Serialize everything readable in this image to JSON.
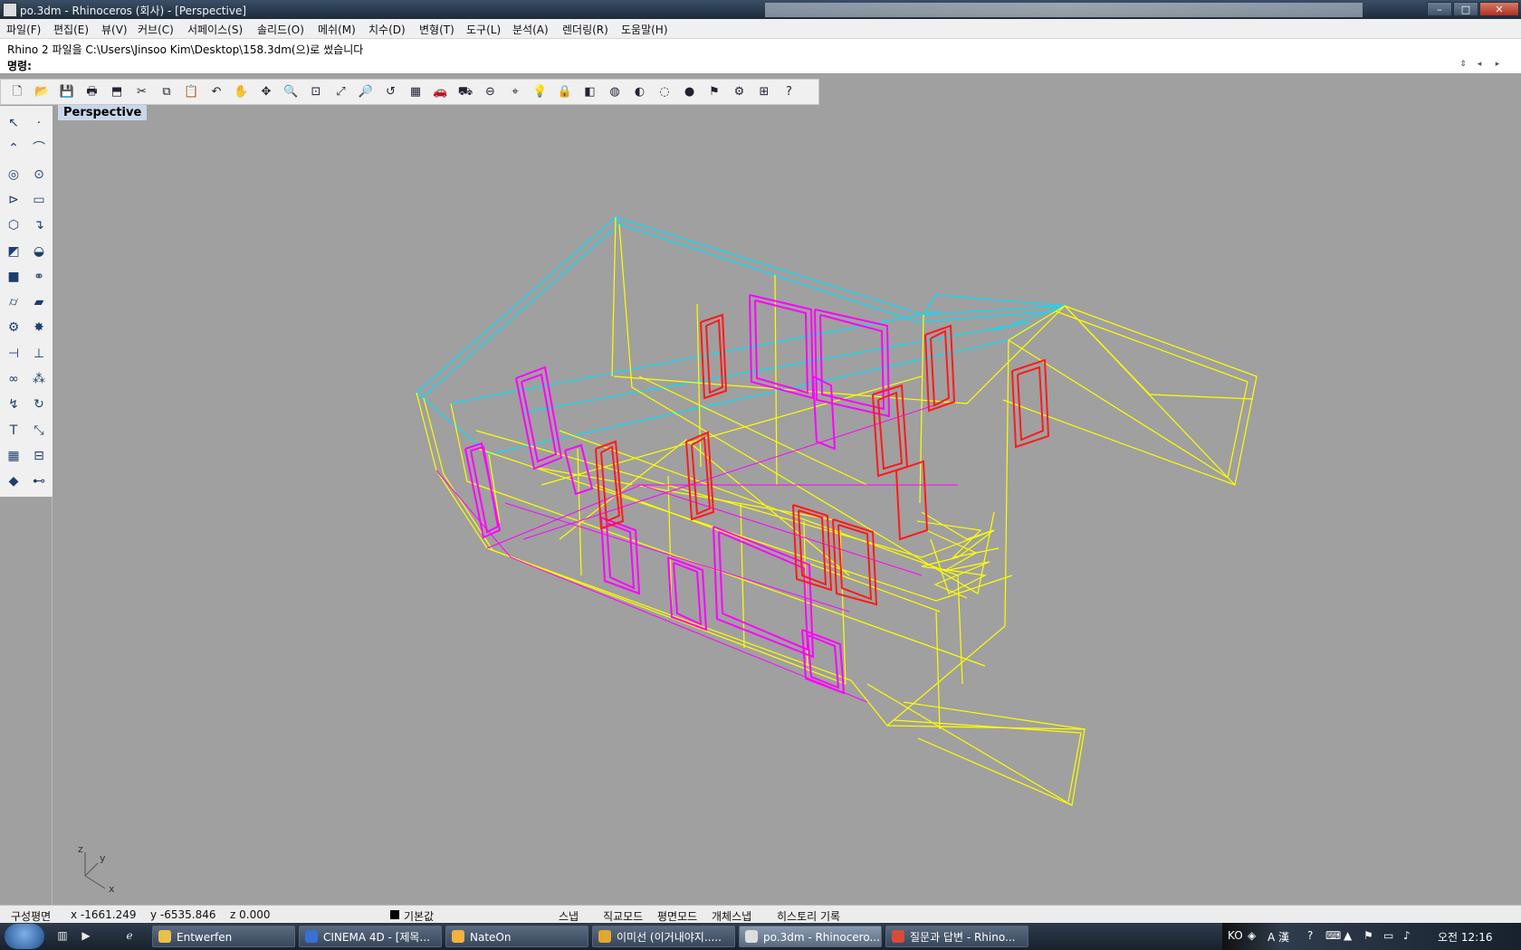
{
  "window": {
    "title": "po.3dm - Rhinoceros (회사) - [Perspective]",
    "controls": {
      "minimize": "–",
      "maximize": "□",
      "close": "✕"
    }
  },
  "menu": [
    "파일(F)",
    "편집(E)",
    "뷰(V)",
    "커브(C)",
    "서페이스(S)",
    "솔리드(O)",
    "메쉬(M)",
    "치수(D)",
    "변형(T)",
    "도구(L)",
    "분석(A)",
    "렌더링(R)",
    "도움말(H)"
  ],
  "command": {
    "history": "Rhino 2 파일을 C:\\Users\\Jinsoo Kim\\Desktop\\158.3dm(으)로 썼습니다",
    "prompt": "명령:"
  },
  "toolbar_icons": [
    "new-file-icon",
    "open-icon",
    "save-icon",
    "print-icon",
    "import-icon",
    "cut-icon",
    "copy-icon",
    "paste-icon",
    "undo-icon",
    "pan-icon",
    "rotate-view-icon",
    "zoom-icon",
    "zoom-window-icon",
    "zoom-extents-icon",
    "zoom-selected-icon",
    "undo-view-icon",
    "four-viewports-icon",
    "car-icon",
    "ghost-icon",
    "cplane-icon",
    "snap-grid-icon",
    "light-icon",
    "lock-icon",
    "layer-icon",
    "color-wheel-icon",
    "wireframe-icon",
    "shaded-icon",
    "render-sphere-icon",
    "pick-icon",
    "options-icon",
    "dimension-icon",
    "help-icon"
  ],
  "toolbar_glyphs": [
    "🗋",
    "📂",
    "💾",
    "🖶",
    "⬒",
    "✂",
    "⧉",
    "📋",
    "↶",
    "✋",
    "✥",
    "🔍",
    "⊡",
    "⤢",
    "🔎",
    "↺",
    "▦",
    "🚗",
    "⛟",
    "⊖",
    "⌖",
    "💡",
    "🔒",
    "◧",
    "◍",
    "◐",
    "◌",
    "●",
    "⚑",
    "⚙",
    "⊞",
    "?"
  ],
  "left_tools": [
    {
      "name": "select-arrow-icon",
      "g": "↖"
    },
    {
      "name": "point-icon",
      "g": "·"
    },
    {
      "name": "polyline-icon",
      "g": "⌃"
    },
    {
      "name": "curve-icon",
      "g": "⌒"
    },
    {
      "name": "circle-icon",
      "g": "◎"
    },
    {
      "name": "ellipse-icon",
      "g": "⊙"
    },
    {
      "name": "arc-icon",
      "g": "⊳"
    },
    {
      "name": "rectangle-icon",
      "g": "▭"
    },
    {
      "name": "polygon-icon",
      "g": "⬡"
    },
    {
      "name": "fillet-curve-icon",
      "g": "↴"
    },
    {
      "name": "surface-icon",
      "g": "◩"
    },
    {
      "name": "revolve-icon",
      "g": "◒"
    },
    {
      "name": "box-solid-icon",
      "g": "■"
    },
    {
      "name": "boolean-icon",
      "g": "⚭"
    },
    {
      "name": "cylinder-icon",
      "g": "⌭"
    },
    {
      "name": "plane-surface-icon",
      "g": "▰"
    },
    {
      "name": "gear-tool-icon",
      "g": "⚙"
    },
    {
      "name": "explode-icon",
      "g": "✸"
    },
    {
      "name": "split-icon",
      "g": "⊣"
    },
    {
      "name": "trim-icon",
      "g": "⊥"
    },
    {
      "name": "join-icon",
      "g": "∞"
    },
    {
      "name": "group-icon",
      "g": "⁂"
    },
    {
      "name": "sweep-icon",
      "g": "↯"
    },
    {
      "name": "rotate-icon",
      "g": "↻"
    },
    {
      "name": "text-icon",
      "g": "T"
    },
    {
      "name": "scale-icon",
      "g": "⤡"
    },
    {
      "name": "array-icon",
      "g": "▦"
    },
    {
      "name": "align-icon",
      "g": "⊟"
    },
    {
      "name": "solid-box-icon",
      "g": "◆"
    },
    {
      "name": "measure-icon",
      "g": "⊷"
    }
  ],
  "viewport": {
    "label": "Perspective",
    "axis_labels": {
      "z": "z",
      "y": "y",
      "x": "x"
    }
  },
  "status": {
    "cplane": "구성평면",
    "x": "x -1661.249",
    "y": "y -6535.846",
    "z": "z 0.000",
    "layer": "기본값",
    "snap": "스냅",
    "ortho": "직교모드",
    "planar": "평면모드",
    "osnap": "개체스냅",
    "history": "히스토리 기록"
  },
  "taskbar": {
    "windows": [
      {
        "label": "Entwerfen",
        "color": "#e8c14a"
      },
      {
        "label": "CINEMA 4D - [제목...",
        "color": "#3b6fd1"
      },
      {
        "label": "NateOn",
        "color": "#f3b23a"
      },
      {
        "label": "이미선 (이거내야지.....",
        "color": "#e0a830"
      },
      {
        "label": "po.3dm - Rhinocero...",
        "color": "#dddddd"
      },
      {
        "label": "질문과 답변 - Rhino...",
        "color": "#d84a3a"
      }
    ],
    "tray_lang": "KO",
    "tray_ime": "A 漢",
    "clock": "오전 12:16"
  },
  "colors": {
    "wire_yellow": "#ffff00",
    "wire_magenta": "#ff00ff",
    "wire_cyan": "#00e0ff",
    "wire_red": "#ff1a1a",
    "viewport_bg": "#a0a0a0"
  }
}
